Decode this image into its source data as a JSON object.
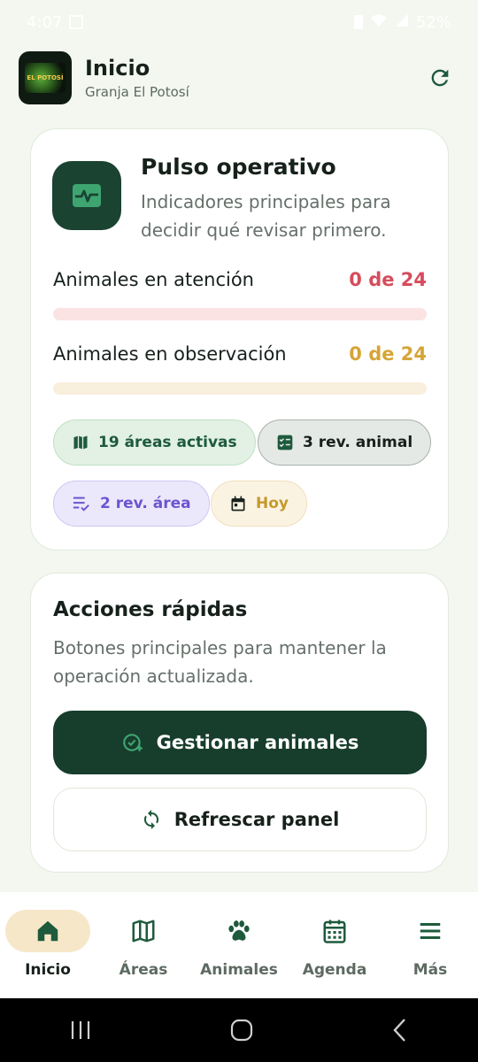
{
  "status_bar": {
    "time": "4:07",
    "battery": "52%"
  },
  "header": {
    "title": "Inicio",
    "subtitle": "Granja El Potosí",
    "logo_text": "EL POTOSÍ"
  },
  "pulse": {
    "title": "Pulso operativo",
    "description": "Indicadores principales para decidir qué revisar primero.",
    "metrics": [
      {
        "label": "Animales en atención",
        "value": "0 de 24",
        "fraction": 0
      },
      {
        "label": "Animales en observación",
        "value": "0 de 24",
        "fraction": 0
      }
    ],
    "chips": [
      {
        "label": "19 áreas activas",
        "icon": "map-icon"
      },
      {
        "label": "3 rev. animal",
        "icon": "checklist-icon"
      },
      {
        "label": "2 rev. área",
        "icon": "list-check-icon"
      },
      {
        "label": "Hoy",
        "icon": "calendar-icon"
      }
    ]
  },
  "actions": {
    "title": "Acciones rápidas",
    "description": "Botones principales para mantener la operación actualizada.",
    "primary_label": "Gestionar animales",
    "secondary_label": "Refrescar panel"
  },
  "nav": {
    "items": [
      {
        "label": "Inicio",
        "icon": "home-icon",
        "active": true
      },
      {
        "label": "Áreas",
        "icon": "map-icon",
        "active": false
      },
      {
        "label": "Animales",
        "icon": "paw-icon",
        "active": false
      },
      {
        "label": "Agenda",
        "icon": "calendar-icon",
        "active": false
      },
      {
        "label": "Más",
        "icon": "menu-icon",
        "active": false
      }
    ]
  },
  "colors": {
    "primary": "#173d2c",
    "attention": "#d64c5c",
    "observation": "#d6a537",
    "background": "#f3f7ef"
  }
}
